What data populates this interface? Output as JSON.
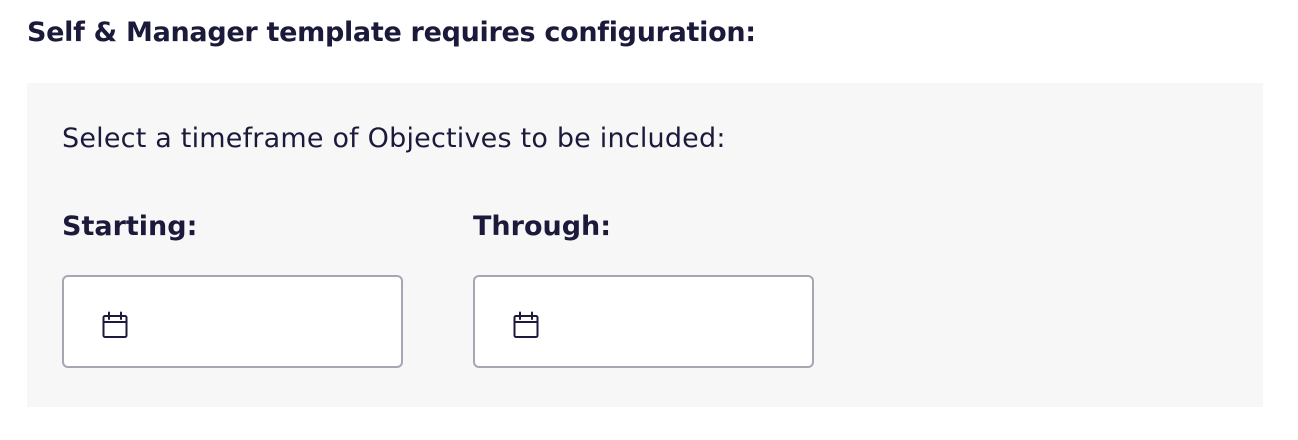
{
  "header": {
    "title": "Self & Manager template requires configuration:"
  },
  "config": {
    "instruction": "Select a timeframe of Objectives to be included:",
    "starting": {
      "label": "Starting:",
      "value": "",
      "icon": "calendar-icon"
    },
    "through": {
      "label": "Through:",
      "value": "",
      "icon": "calendar-icon"
    }
  },
  "colors": {
    "text": "#1b1a3a",
    "panel_bg": "#f7f7f7",
    "input_border": "#a7a6b3"
  }
}
